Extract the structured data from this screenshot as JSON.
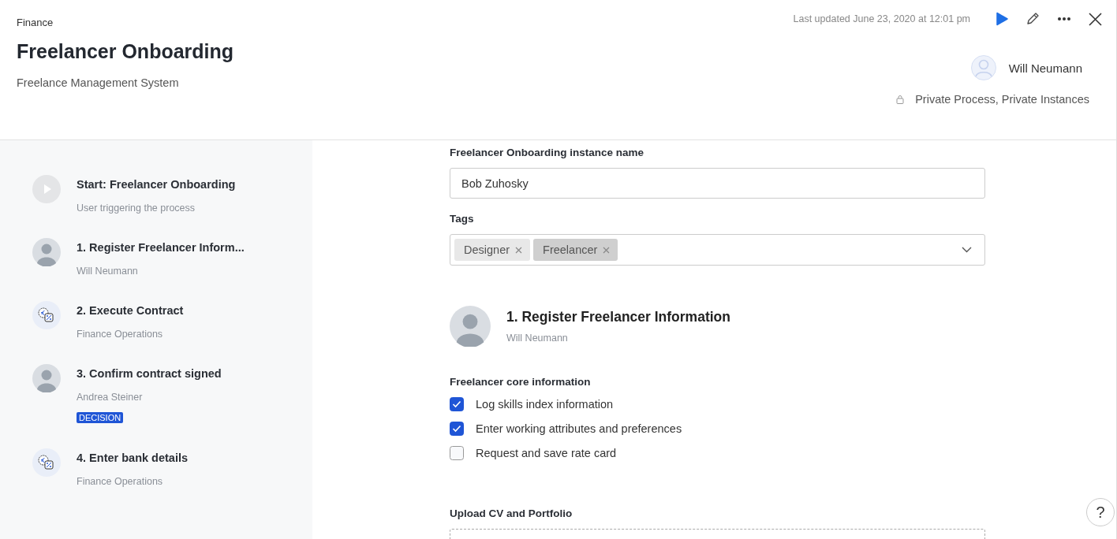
{
  "header": {
    "breadcrumb": "Finance",
    "title": "Freelancer Onboarding",
    "subtitle": "Freelance Management System",
    "last_updated": "Last updated June 23, 2020 at 12:01 pm",
    "owner": "Will Neumann",
    "privacy": "Private Process, Private Instances"
  },
  "steps": [
    {
      "kind": "start",
      "title": "Start: Freelancer Onboarding",
      "subtitle": "User triggering the process"
    },
    {
      "kind": "person",
      "title": "1. Register Freelancer Inform...",
      "subtitle": "Will Neumann"
    },
    {
      "kind": "finance",
      "title": "2. Execute Contract",
      "subtitle": "Finance Operations"
    },
    {
      "kind": "person",
      "title": "3. Confirm contract signed",
      "subtitle": "Andrea Steiner",
      "badge": "DECISION"
    },
    {
      "kind": "finance",
      "title": "4. Enter bank details",
      "subtitle": "Finance Operations"
    }
  ],
  "form": {
    "instance_label": "Freelancer Onboarding instance name",
    "instance_value": "Bob Zuhosky",
    "tags_label": "Tags",
    "tags": [
      {
        "label": "Designer",
        "selected": false
      },
      {
        "label": "Freelancer",
        "selected": true
      }
    ],
    "task": {
      "title": "1. Register Freelancer Information",
      "assignee": "Will Neumann"
    },
    "checklist_title": "Freelancer core information",
    "checklist": [
      {
        "label": "Log skills index information",
        "checked": true
      },
      {
        "label": "Enter working attributes and preferences",
        "checked": true
      },
      {
        "label": "Request and save rate card",
        "checked": false
      }
    ],
    "upload_label": "Upload CV and Portfolio"
  },
  "help": "?"
}
